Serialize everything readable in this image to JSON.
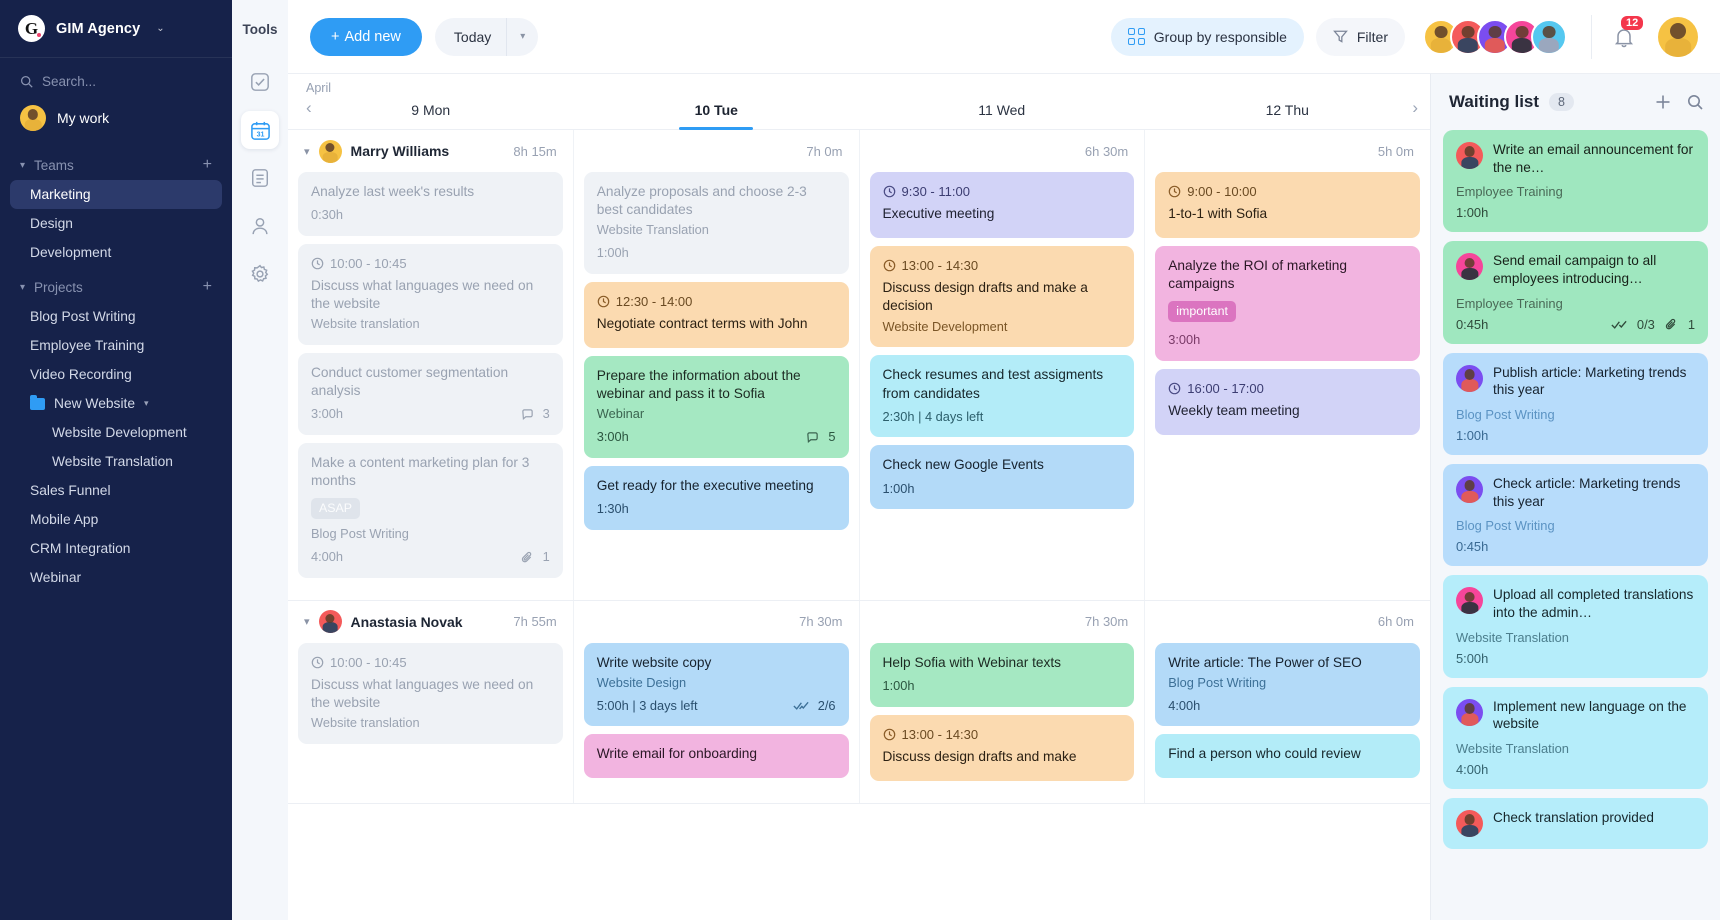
{
  "sidebar": {
    "brand": {
      "name": "GIM Agency",
      "logo_letter": "G",
      "caret": "⌄"
    },
    "search_placeholder": "Search...",
    "my_work_label": "My work",
    "groups": [
      {
        "label": "Teams",
        "add": "+"
      },
      {
        "label": "Projects",
        "add": "+"
      }
    ],
    "teams": [
      {
        "label": "Marketing",
        "active": true
      },
      {
        "label": "Design",
        "active": false
      },
      {
        "label": "Development",
        "active": false
      }
    ],
    "projects": [
      {
        "label": "Blog Post Writing"
      },
      {
        "label": "Employee Training"
      },
      {
        "label": "Video Recording"
      },
      {
        "label": "New Website",
        "folder": true,
        "caret": "⌄"
      },
      {
        "label": "Website Development",
        "sub": true
      },
      {
        "label": "Website Translation",
        "sub": true
      },
      {
        "label": "Sales Funnel"
      },
      {
        "label": "Mobile App"
      },
      {
        "label": "CRM Integration"
      },
      {
        "label": "Webinar"
      }
    ]
  },
  "tools": {
    "title": "Tools",
    "items": [
      {
        "icon": "checkbox-icon",
        "active": false
      },
      {
        "icon": "calendar-31-icon",
        "active": true
      },
      {
        "icon": "document-list-icon",
        "active": false
      },
      {
        "icon": "person-icon",
        "active": false
      },
      {
        "icon": "gear-icon",
        "active": false
      }
    ]
  },
  "topbar": {
    "add_new_label": "Add new",
    "add_new_plus": "+",
    "today_label": "Today",
    "today_caret": "⌄",
    "group_by_label": "Group by responsible",
    "filter_label": "Filter",
    "notification_count": "12",
    "avatars": [
      "yellow",
      "red",
      "purple",
      "pink",
      "cyan"
    ],
    "user_avatar": "yellow"
  },
  "calendar": {
    "month": "April",
    "prev": "‹",
    "next": "›",
    "days": [
      {
        "label": "9 Mon",
        "active": false
      },
      {
        "label": "10 Tue",
        "active": true
      },
      {
        "label": "11 Wed",
        "active": false
      },
      {
        "label": "12 Thu",
        "active": false
      }
    ]
  },
  "people_rows": [
    {
      "name": "Marry Williams",
      "avatar": "yellow",
      "totals": [
        "8h 15m",
        "7h 0m",
        "6h 30m",
        "5h 0m"
      ],
      "columns": [
        [
          {
            "color": "gray",
            "title": "Analyze last week's results",
            "hours": "0:30h"
          },
          {
            "color": "gray",
            "time": "10:00 - 10:45",
            "title": "Discuss what languages we need on the website",
            "project": "Website translation"
          },
          {
            "color": "gray",
            "title": "Conduct customer segmentation analysis",
            "hours": "3:00h",
            "comments": "3"
          },
          {
            "color": "gray",
            "title": "Make a content marketing plan for 3 months",
            "tag": "ASAP",
            "project": "Blog Post Writing",
            "hours": "4:00h",
            "attachments": "1"
          }
        ],
        [
          {
            "color": "gray",
            "title": "Analyze proposals and choose 2-3 best candidates",
            "project": "Website Translation",
            "hours": "1:00h"
          },
          {
            "color": "peach",
            "time": "12:30 - 14:00",
            "title": "Negotiate contract terms with John"
          },
          {
            "color": "green",
            "title": "Prepare the information about the webinar and pass it to Sofia",
            "project": "Webinar",
            "hours": "3:00h",
            "comments": "5"
          },
          {
            "color": "blue",
            "title": "Get ready for the executive meeting",
            "hours": "1:30h"
          }
        ],
        [
          {
            "color": "lilac",
            "time": "9:30 - 11:00",
            "title": "Executive meeting"
          },
          {
            "color": "peach",
            "time": "13:00 - 14:30",
            "title": "Discuss design drafts and make a decision",
            "project": "Website Development"
          },
          {
            "color": "cyan",
            "title": "Check resumes and test assigments from candidates",
            "hours": "2:30h | 4 days left"
          },
          {
            "color": "blue",
            "title": "Check new Google Events",
            "hours": "1:00h"
          }
        ],
        [
          {
            "color": "peach",
            "time": "9:00 - 10:00",
            "title": "1-to-1 with Sofia"
          },
          {
            "color": "pink",
            "title": "Analyze the ROI of marketing campaigns",
            "tag": "important",
            "hours": "3:00h"
          },
          {
            "color": "lilac",
            "time": "16:00 - 17:00",
            "title": "Weekly team meeting"
          }
        ]
      ]
    },
    {
      "name": "Anastasia Novak",
      "avatar": "red",
      "totals": [
        "7h 55m",
        "7h 30m",
        "7h 30m",
        "6h 0m"
      ],
      "columns": [
        [
          {
            "color": "gray",
            "time": "10:00 - 10:45",
            "title": "Discuss what languages we need on the website",
            "project": "Website translation"
          }
        ],
        [
          {
            "color": "blue",
            "title": "Write website copy",
            "project": "Website Design",
            "hours": "5:00h | 3 days left",
            "checks": "2/6"
          },
          {
            "color": "pink",
            "title": "Write email for onboarding"
          }
        ],
        [
          {
            "color": "green",
            "title": "Help Sofia with Webinar texts",
            "hours": "1:00h"
          },
          {
            "color": "peach",
            "time": "13:00 - 14:30",
            "title": "Discuss design drafts and make"
          }
        ],
        [
          {
            "color": "blue",
            "title": "Write article: The Power of SEO",
            "project": "Blog Post Writing",
            "hours": "4:00h"
          },
          {
            "color": "cyan",
            "title": "Find a person who could review"
          }
        ]
      ]
    }
  ],
  "waiting_list": {
    "title": "Waiting list",
    "count": "8",
    "add_icon": "plus-icon",
    "search_icon": "search-icon",
    "items": [
      {
        "color": "green",
        "avatar": "red",
        "title": "Write an email announcement for the ne…",
        "project": "Employee Training",
        "hours": "1:00h"
      },
      {
        "color": "green",
        "avatar": "pink",
        "title": "Send email campaign to all employees introducing…",
        "project": "Employee Training",
        "hours": "0:45h",
        "checks": "0/3",
        "attachments": "1"
      },
      {
        "color": "blue",
        "avatar": "purple",
        "title": "Publish article: Marketing trends this year",
        "project": "Blog Post Writing",
        "hours": "1:00h"
      },
      {
        "color": "blue",
        "avatar": "purple",
        "title": "Check article: Marketing trends this year",
        "project": "Blog Post Writing",
        "hours": "0:45h"
      },
      {
        "color": "cyan",
        "avatar": "pink",
        "title": "Upload all completed translations into the admin…",
        "project": "Website Translation",
        "hours": "5:00h"
      },
      {
        "color": "cyan",
        "avatar": "purple",
        "title": "Implement new language on the website",
        "project": "Website Translation",
        "hours": "4:00h"
      },
      {
        "color": "cyan",
        "avatar": "red",
        "title": "Check translation provided",
        "project": "",
        "hours": ""
      }
    ]
  }
}
